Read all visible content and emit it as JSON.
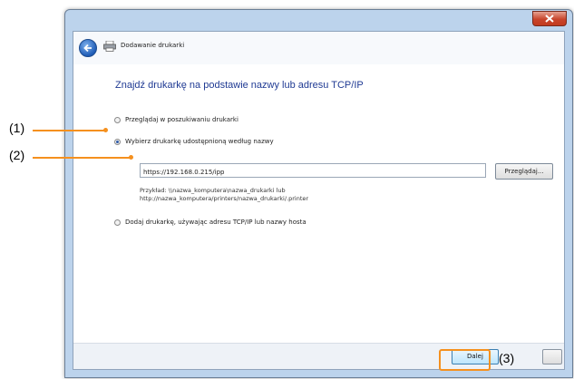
{
  "window": {
    "title": "Dodawanie drukarki"
  },
  "heading": "Znajdź drukarkę na podstawie nazwy lub adresu TCP/IP",
  "options": [
    {
      "label": "Przeglądaj w poszukiwaniu drukarki",
      "checked": false
    },
    {
      "label": "Wybierz drukarkę udostępnioną według nazwy",
      "checked": true
    },
    {
      "label": "Dodaj drukarkę, używając adresu TCP/IP lub nazwy hosta",
      "checked": false
    }
  ],
  "url_input": {
    "value": "https://192.168.0.215/ipp"
  },
  "browse_button": "Przeglądaj...",
  "example": {
    "line1": "Przykład: \\\\nazwa_komputera\\nazwa_drukarki lub",
    "line2": "http://nazwa_komputera/printers/nazwa_drukarki/.printer"
  },
  "next_button": "Dalej",
  "callouts": {
    "c1": "(1)",
    "c2": "(2)",
    "c3": "(3)"
  },
  "colors": {
    "callout": "#f5901e",
    "heading": "#1f3a93"
  }
}
